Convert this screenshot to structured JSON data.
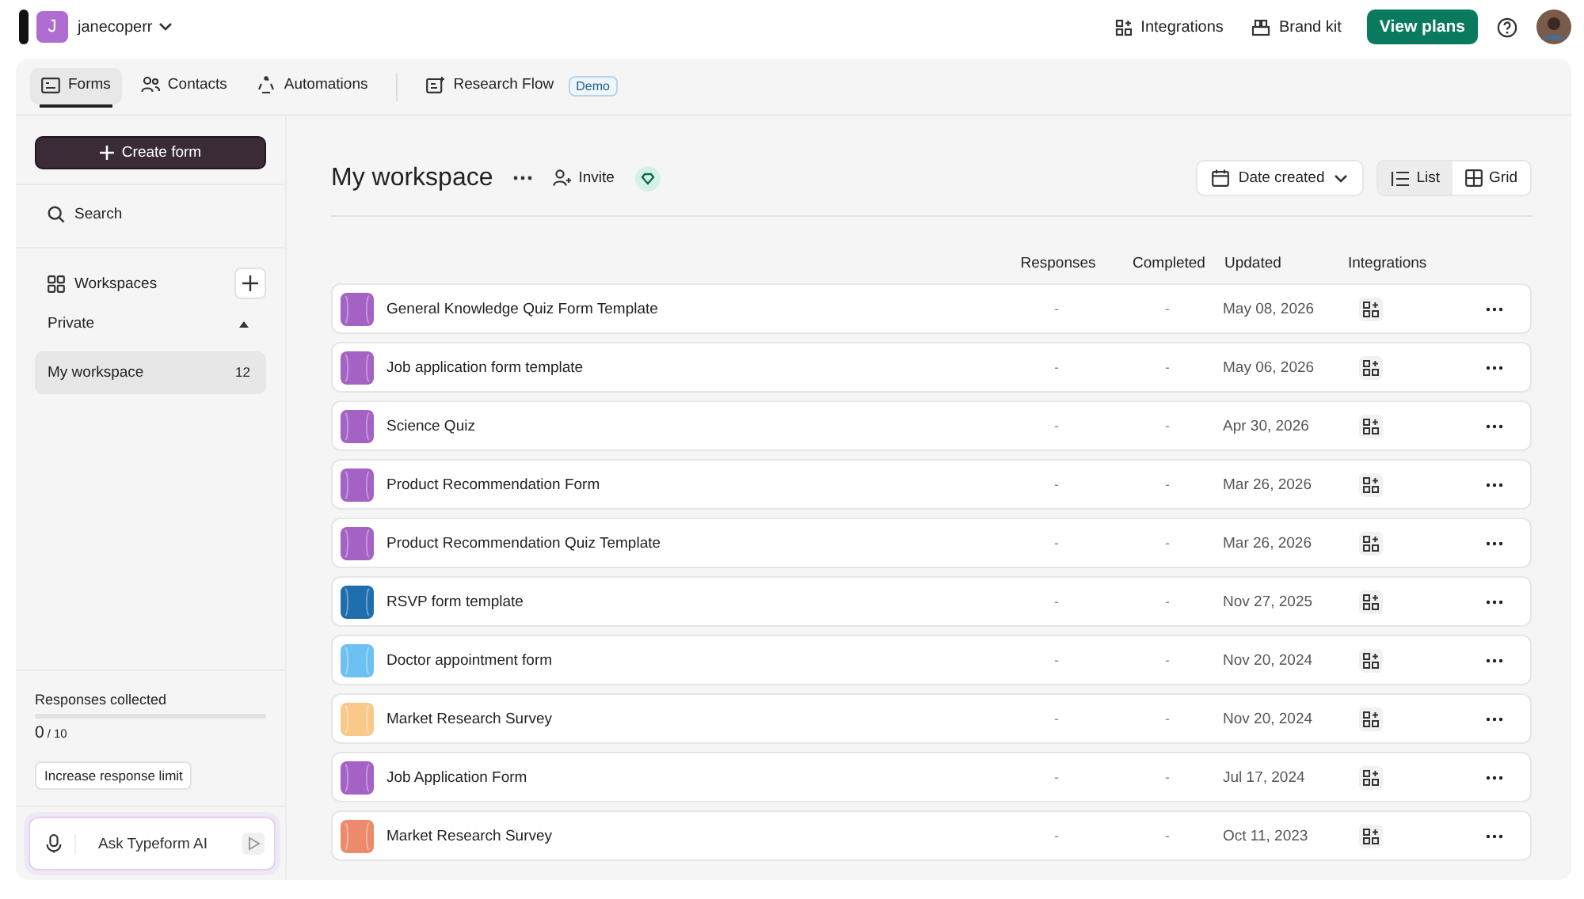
{
  "account": {
    "initial": "J",
    "name": "janecoperr"
  },
  "top_actions": [
    {
      "label": "Integrations",
      "kind": "integrations"
    },
    {
      "label": "Brand kit",
      "kind": "brand"
    }
  ],
  "upgrade_button": "View plans",
  "tabs": [
    {
      "label": "Forms",
      "selected": true,
      "kind": "forms"
    },
    {
      "label": "Contacts",
      "selected": false,
      "kind": "contacts"
    },
    {
      "label": "Automations",
      "selected": false,
      "kind": "automations"
    }
  ],
  "flow": {
    "label": "Research Flow",
    "badge": "Demo"
  },
  "sidebar": {
    "create_button": "Create form",
    "search": "Search",
    "workspaces_label": "Workspaces",
    "group": {
      "label": "Private",
      "expanded": true
    },
    "items": [
      {
        "label": "My workspace",
        "count": "12",
        "selected": true
      }
    ],
    "usage": {
      "label": "Responses collected",
      "level": 0,
      "count": "0",
      "limit": "/ 10",
      "button": "Increase response limit"
    },
    "ai": {
      "placeholder": "Ask Typeform AI"
    }
  },
  "workspace": {
    "title": "My workspace",
    "invite": "Invite",
    "sort": "Date created",
    "views": [
      {
        "label": "List",
        "selected": true,
        "kind": "list"
      },
      {
        "label": "Grid",
        "selected": false,
        "kind": "grid"
      }
    ]
  },
  "table": {
    "columns": [
      "Responses",
      "Completed",
      "Updated",
      "Integrations"
    ],
    "rows": [
      {
        "name": "General Knowledge Quiz Form Template",
        "responses": "-",
        "completed": "-",
        "updated": "May 08, 2026",
        "color": "#a462c4"
      },
      {
        "name": "Job application form template",
        "responses": "-",
        "completed": "-",
        "updated": "May 06, 2026",
        "color": "#a462c4"
      },
      {
        "name": "Science Quiz",
        "responses": "-",
        "completed": "-",
        "updated": "Apr 30, 2026",
        "color": "#a462c4"
      },
      {
        "name": "Product Recommendation Form",
        "responses": "-",
        "completed": "-",
        "updated": "Mar 26, 2026",
        "color": "#a462c4"
      },
      {
        "name": "Product Recommendation Quiz Template",
        "responses": "-",
        "completed": "-",
        "updated": "Mar 26, 2026",
        "color": "#a462c4"
      },
      {
        "name": "RSVP form template",
        "responses": "-",
        "completed": "-",
        "updated": "Nov 27, 2025",
        "color": "#1f6fae"
      },
      {
        "name": "Doctor appointment form",
        "responses": "-",
        "completed": "-",
        "updated": "Nov 20, 2024",
        "color": "#6cc1f2"
      },
      {
        "name": "Market Research Survey",
        "responses": "-",
        "completed": "-",
        "updated": "Nov 20, 2024",
        "color": "#f9c98a"
      },
      {
        "name": "Job Application Form",
        "responses": "-",
        "completed": "-",
        "updated": "Jul 17, 2024",
        "color": "#a462c4"
      },
      {
        "name": "Market Research Survey",
        "responses": "-",
        "completed": "-",
        "updated": "Oct 11, 2023",
        "color": "#ec8a6c"
      }
    ]
  }
}
